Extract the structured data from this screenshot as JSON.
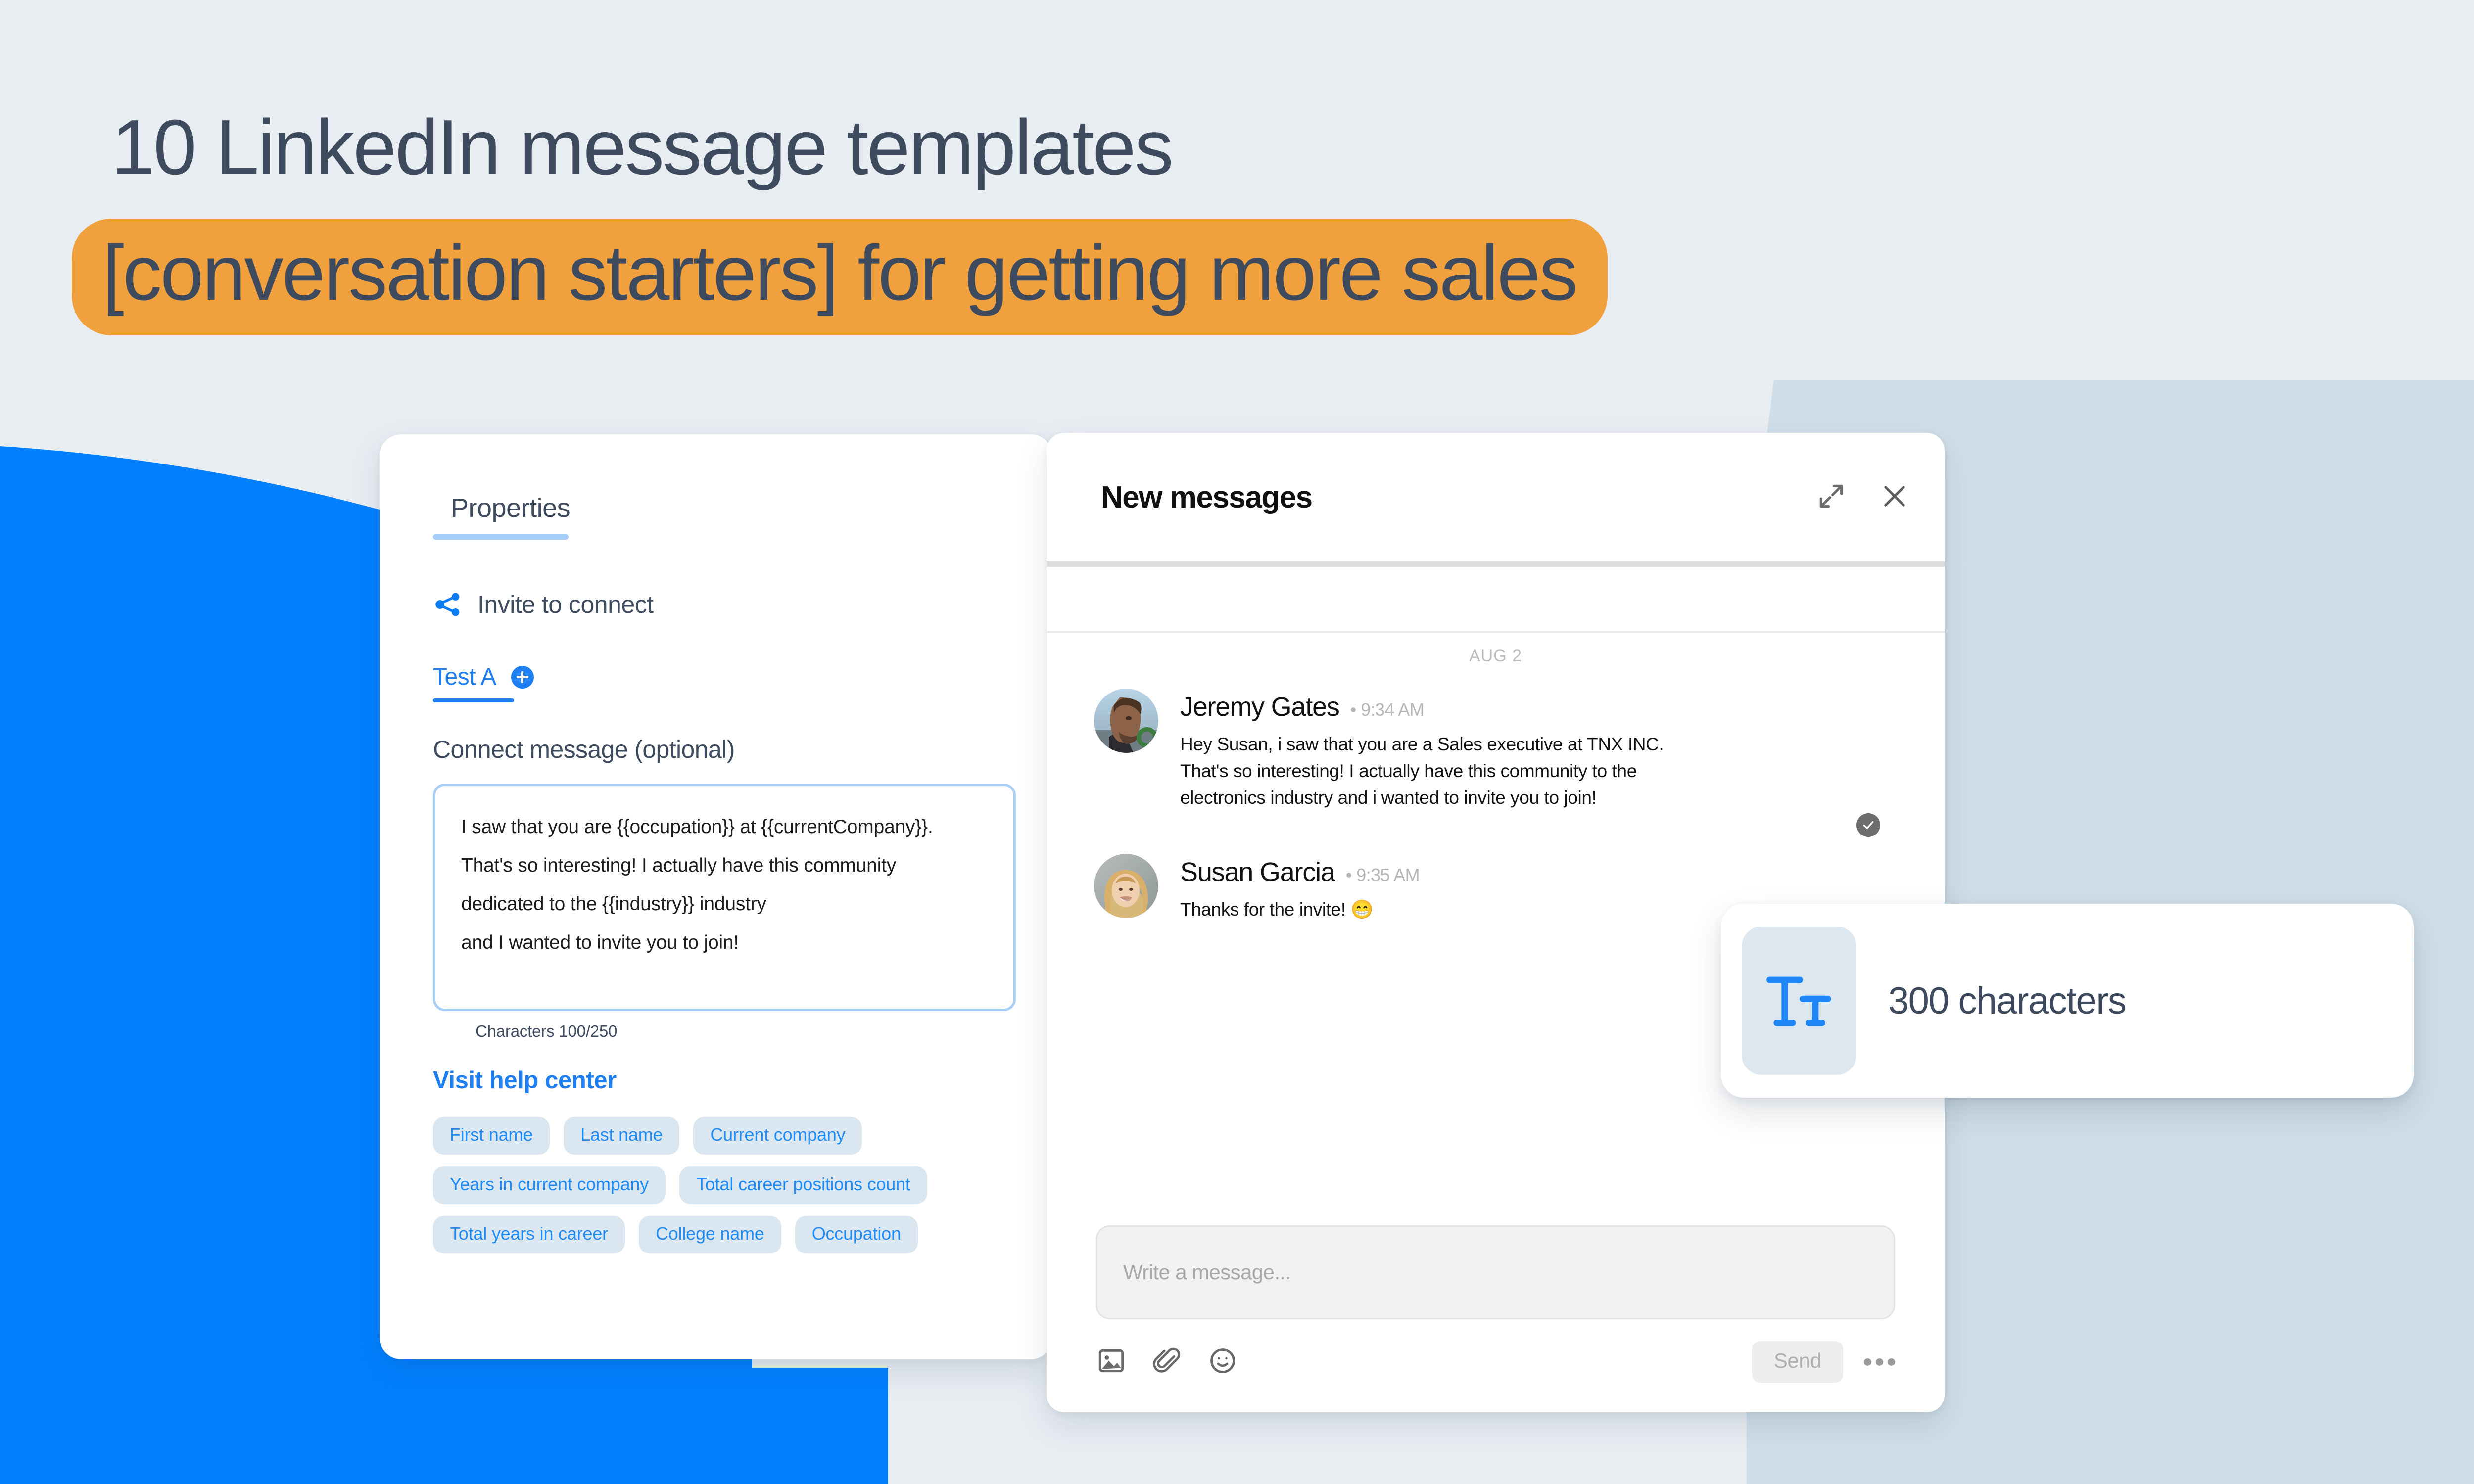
{
  "theme": {
    "page_background": "#e8edf2",
    "brand_blue": "#0080ff",
    "accent_orange": "#f0a03c",
    "heading_slate": "#3e4a5e",
    "link_blue": "#1f7ef0",
    "chip_background": "#dbe7f0",
    "soft_panel_blue": "#cfdee8"
  },
  "headline": {
    "line1": "10 LinkedIn message templates",
    "line2": "[conversation starters] for getting more sales"
  },
  "properties_panel": {
    "tab_label": "Properties",
    "invite": {
      "icon": "share-icon",
      "label": "Invite to connect"
    },
    "variant_tab": {
      "label": "Test A",
      "add_icon": "plus-circle-icon"
    },
    "connect_message_label": "Connect message (optional)",
    "message_lines": [
      "I saw that you are {{occupation}} at {{currentCompany}}.",
      "That's so interesting! I actually have this community",
      "dedicated to the {{industry}} industry",
      "and I wanted to invite you to join!"
    ],
    "character_counter": "Characters 100/250",
    "help_link": "Visit help center",
    "chips": [
      "First name",
      "Last name",
      "Current company",
      "Years in current company",
      "Total career positions count",
      "Total years in career",
      "College name",
      "Occupation"
    ]
  },
  "chat_panel": {
    "title": "New messages",
    "expand_icon": "expand-diagonal-icon",
    "close_icon": "close-icon",
    "date_separator": "AUG 2",
    "messages": [
      {
        "name": "Jeremy Gates",
        "time": "• 9:34 AM",
        "text": "Hey Susan, i saw that you are a Sales executive at TNX INC.\nThat's so interesting! I actually have this community to the\nelectronics industry and i wanted to invite you to join!",
        "presence": "online",
        "read_receipt_icon": "check-circle-icon"
      },
      {
        "name": "Susan Garcia",
        "time": "• 9:35 AM",
        "text": "Thanks for the invite! 😁",
        "presence": "none",
        "read_receipt_icon": ""
      }
    ],
    "composer": {
      "placeholder": "Write a message...",
      "tools": [
        "image-icon",
        "paperclip-icon",
        "emoji-icon"
      ],
      "send_label": "Send",
      "more_icon": "more-horizontal-icon"
    }
  },
  "callout": {
    "icon": "text-size-icon",
    "label": "300 characters"
  }
}
